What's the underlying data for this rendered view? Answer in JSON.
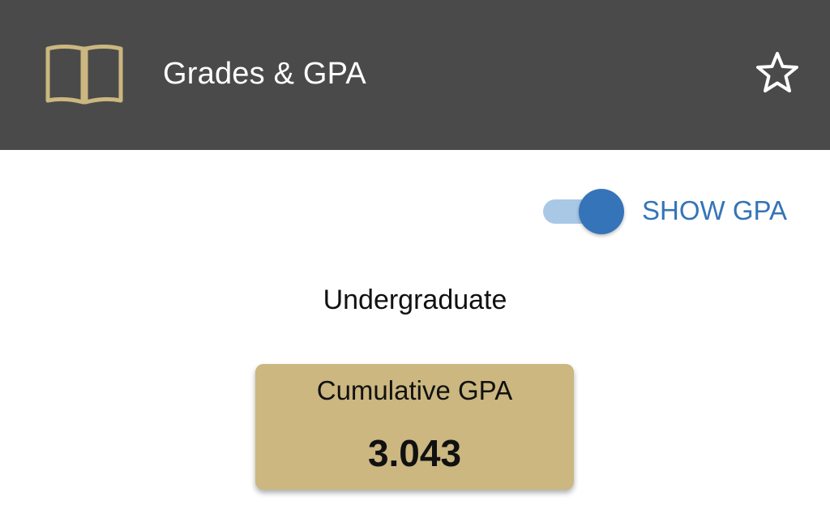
{
  "header": {
    "title": "Grades & GPA",
    "icon": "book-icon",
    "favorite_icon": "star-icon",
    "background_color": "#4a4a4a",
    "icon_color": "#cbb77f"
  },
  "toggle": {
    "label": "SHOW GPA",
    "state": "on",
    "accent_color": "#3574b8"
  },
  "content": {
    "section_title": "Undergraduate",
    "card": {
      "label": "Cumulative GPA",
      "value": "3.043",
      "background_color": "#cbb77f"
    }
  }
}
